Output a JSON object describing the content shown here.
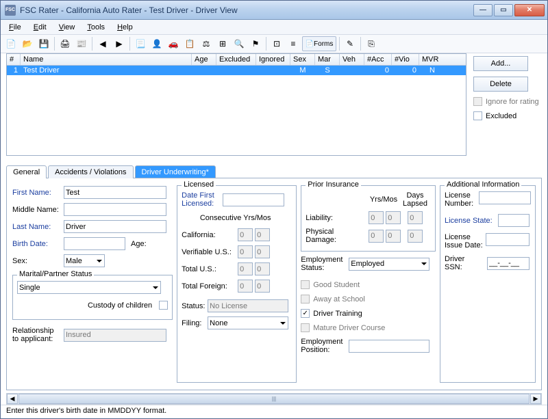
{
  "window": {
    "title": "FSC Rater - California Auto Rater - Test Driver - Driver View"
  },
  "menu": {
    "file": "File",
    "edit": "Edit",
    "view": "View",
    "tools": "Tools",
    "help": "Help"
  },
  "forms_btn": "Forms",
  "grid": {
    "headers": {
      "num": "#",
      "name": "Name",
      "age": "Age",
      "excl": "Excluded",
      "ign": "Ignored",
      "sex": "Sex",
      "mar": "Mar",
      "veh": "Veh",
      "acc": "#Acc",
      "vio": "#Vio",
      "mvr": "MVR"
    },
    "row": {
      "num": "1",
      "name": "Test Driver",
      "age": "",
      "excl": "",
      "ign": "",
      "sex": "M",
      "mar": "S",
      "veh": "",
      "acc": "0",
      "vio": "0",
      "mvr": "N"
    }
  },
  "side": {
    "add": "Add...",
    "delete": "Delete",
    "ignore": "Ignore for rating",
    "excluded": "Excluded"
  },
  "tabs": {
    "general": "General",
    "acc": "Accidents / Violations",
    "uw": "Driver Underwriting*"
  },
  "general": {
    "first_lbl": "First Name:",
    "first_val": "Test",
    "middle_lbl": "Middle Name:",
    "middle_val": "",
    "last_lbl": "Last Name:",
    "last_val": "Driver",
    "birth_lbl": "Birth Date:",
    "birth_val": "",
    "age_lbl": "Age:",
    "sex_lbl": "Sex:",
    "sex_val": "Male",
    "marital_group": "Marital/Partner Status",
    "marital_val": "Single",
    "custody_lbl": "Custody of children",
    "rel_lbl": "Relationship to applicant:",
    "rel_val": "Insured"
  },
  "licensed": {
    "group": "Licensed",
    "date_lbl": "Date First Licensed:",
    "date_val": "",
    "cons_lbl": "Consecutive Yrs/Mos",
    "ca_lbl": "California:",
    "ca_y": "0",
    "ca_m": "0",
    "vu_lbl": "Verifiable U.S.:",
    "vu_y": "0",
    "vu_m": "0",
    "tu_lbl": "Total U.S.:",
    "tu_y": "0",
    "tu_m": "0",
    "tf_lbl": "Total Foreign:",
    "tf_y": "0",
    "tf_m": "0",
    "status_lbl": "Status:",
    "status_val": "No License",
    "filing_lbl": "Filing:",
    "filing_val": "None"
  },
  "prior": {
    "group": "Prior Insurance",
    "ym_lbl": "Yrs/Mos",
    "days_lbl": "Days Lapsed",
    "liab_lbl": "Liability:",
    "liab_y": "0",
    "liab_m": "0",
    "liab_d": "0",
    "pd_lbl": "Physical Damage:",
    "pd_y": "0",
    "pd_m": "0",
    "pd_d": "0",
    "emp_lbl": "Employment Status:",
    "emp_val": "Employed",
    "good": "Good Student",
    "away": "Away at School",
    "train": "Driver Training",
    "mature": "Mature Driver Course",
    "pos_lbl": "Employment Position:",
    "pos_val": ""
  },
  "addl": {
    "group": "Additional Information",
    "licnum_lbl": "License Number:",
    "licnum_val": "",
    "licstate_lbl": "License State:",
    "licstate_val": "",
    "licdate_lbl": "License Issue Date:",
    "licdate_val": "",
    "ssn_lbl": "Driver SSN:",
    "ssn_val": "__-__-__"
  },
  "status_text": "Enter this driver's birth date in MMDDYY format."
}
